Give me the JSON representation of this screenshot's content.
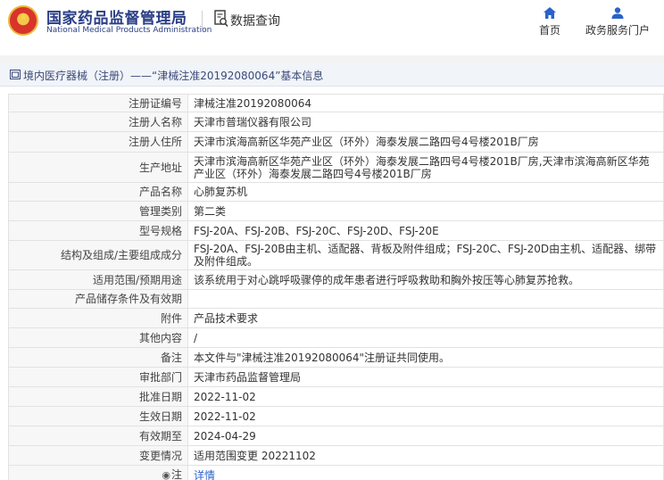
{
  "header": {
    "site_title_cn": "国家药品监督管理局",
    "site_title_en": "National Medical Products Administration",
    "data_query": "数据查询",
    "nav": {
      "home": "首页",
      "service": "政务服务门户"
    }
  },
  "breadcrumb": "境内医疗器械（注册）——“津械注准20192080064”基本信息",
  "rows": [
    {
      "label": "注册证编号",
      "value": "津械注准20192080064"
    },
    {
      "label": "注册人名称",
      "value": "天津市普瑞仪器有限公司"
    },
    {
      "label": "注册人住所",
      "value": "天津市滨海高新区华苑产业区（环外）海泰发展二路四号4号楼201B厂房"
    },
    {
      "label": "生产地址",
      "value": "天津市滨海高新区华苑产业区（环外）海泰发展二路四号4号楼201B厂房,天津市滨海高新区华苑产业区（环外）海泰发展二路四号4号楼201B厂房"
    },
    {
      "label": "产品名称",
      "value": "心肺复苏机"
    },
    {
      "label": "管理类别",
      "value": "第二类"
    },
    {
      "label": "型号规格",
      "value": "FSJ-20A、FSJ-20B、FSJ-20C、FSJ-20D、FSJ-20E"
    },
    {
      "label": "结构及组成/主要组成成分",
      "value": "FSJ-20A、FSJ-20B由主机、适配器、背板及附件组成；FSJ-20C、FSJ-20D由主机、适配器、绑带及附件组成。"
    },
    {
      "label": "适用范围/预期用途",
      "value": "该系统用于对心跳呼吸骤停的成年患者进行呼吸救助和胸外按压等心肺复苏抢救。"
    },
    {
      "label": "产品储存条件及有效期",
      "value": ""
    },
    {
      "label": "附件",
      "value": "产品技术要求"
    },
    {
      "label": "其他内容",
      "value": "/"
    },
    {
      "label": "备注",
      "value": "本文件与\"津械注准20192080064\"注册证共同使用。"
    },
    {
      "label": "审批部门",
      "value": "天津市药品监督管理局"
    },
    {
      "label": "批准日期",
      "value": "2022-11-02"
    },
    {
      "label": "生效日期",
      "value": "2022-11-02"
    },
    {
      "label": "有效期至",
      "value": "2024-04-29"
    },
    {
      "label": "变更情况",
      "value": "适用范围变更 20221102"
    },
    {
      "label": "注",
      "value": "详情"
    }
  ]
}
